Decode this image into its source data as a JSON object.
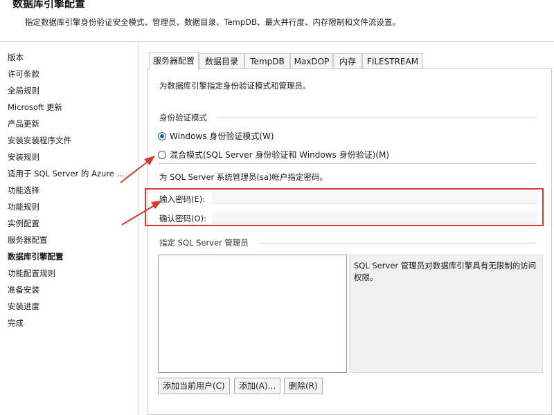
{
  "header": {
    "title": "数据库引擎配置",
    "subtitle": "指定数据库引擎身份验证安全模式、管理员、数据目录、TempDB、最大并行度、内存限制和文件流设置。"
  },
  "nav": {
    "items": [
      {
        "label": "版本"
      },
      {
        "label": "许可条款"
      },
      {
        "label": "全局规则"
      },
      {
        "label": "Microsoft 更新"
      },
      {
        "label": "产品更新"
      },
      {
        "label": "安装安装程序文件"
      },
      {
        "label": "安装规则"
      },
      {
        "label": "适用于 SQL Server 的 Azure ..."
      },
      {
        "label": "功能选择"
      },
      {
        "label": "功能规则"
      },
      {
        "label": "实例配置"
      },
      {
        "label": "服务器配置"
      },
      {
        "label": "数据库引擎配置"
      },
      {
        "label": "功能配置规则"
      },
      {
        "label": "准备安装"
      },
      {
        "label": "安装进度"
      },
      {
        "label": "完成"
      }
    ],
    "active_index": 12
  },
  "tabs": [
    {
      "label": "服务器配置"
    },
    {
      "label": "数据目录"
    },
    {
      "label": "TempDB"
    },
    {
      "label": "MaxDOP"
    },
    {
      "label": "内存"
    },
    {
      "label": "FILESTREAM"
    }
  ],
  "panel": {
    "description": "为数据库引擎指定身份验证模式和管理员。",
    "auth_group_title": "身份验证模式",
    "auth_options": [
      {
        "label": "Windows 身份验证模式(W)",
        "checked": true
      },
      {
        "label": "混合模式(SQL Server 身份验证和 Windows 身份验证)(M)",
        "checked": false
      }
    ],
    "password_hint": "为 SQL Server 系统管理员(sa)帐户指定密码。",
    "enter_password_label": "输入密码(E):",
    "enter_password_value": "",
    "confirm_password_label": "确认密码(O):",
    "confirm_password_value": "",
    "admins_group_title": "指定 SQL Server 管理员",
    "admins_info": "SQL Server 管理员对数据库引擎具有无限制的访问权限。",
    "buttons": {
      "add_current_user": "添加当前用户(C)",
      "add": "添加(A)...",
      "remove": "删除(R)"
    }
  },
  "annotations": {
    "highlight_color": "#d63a2d",
    "arrow_color": "#d63a2d"
  }
}
